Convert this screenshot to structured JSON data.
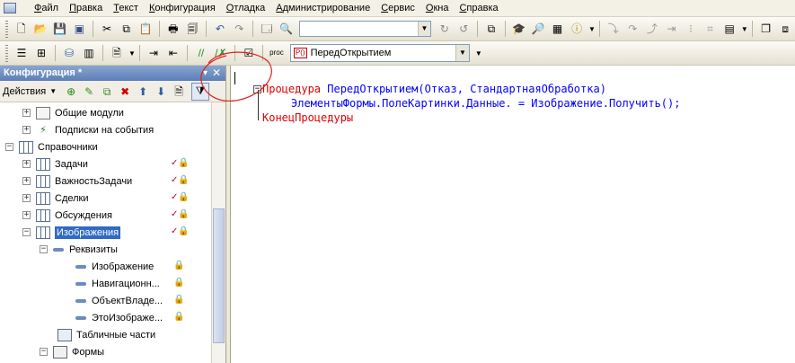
{
  "menu": [
    "Файл",
    "Правка",
    "Текст",
    "Конфигурация",
    "Отладка",
    "Администрирование",
    "Сервис",
    "Окна",
    "Справка"
  ],
  "toolbar2": {
    "procedure_badge": "P()",
    "procedure_selected": "ПередОткрытием"
  },
  "panel": {
    "title": "Конфигурация *",
    "actions_label": "Действия"
  },
  "tree": [
    {
      "label": "Общие модули"
    },
    {
      "label": "Подписки на события"
    },
    {
      "label": "Справочники"
    },
    {
      "label": "Задачи"
    },
    {
      "label": "ВажностьЗадачи"
    },
    {
      "label": "Сделки"
    },
    {
      "label": "Обсуждения"
    },
    {
      "label": "Изображения"
    },
    {
      "label": "Реквизиты"
    },
    {
      "label": "Изображение"
    },
    {
      "label": "Навигационн..."
    },
    {
      "label": "ОбъектВладе..."
    },
    {
      "label": "ЭтоИзображе..."
    },
    {
      "label": "Табличные части"
    },
    {
      "label": "Формы"
    }
  ],
  "code": {
    "line1_kw": "Процедура",
    "line1_rest": " ПередОткрытием(Отказ, СтандартнаяОбработка)",
    "line2": "ЭлементыФормы.ПолеКартинки.Данные. = Изображение.Получить();",
    "line3_kw": "КонецПроцедуры"
  }
}
